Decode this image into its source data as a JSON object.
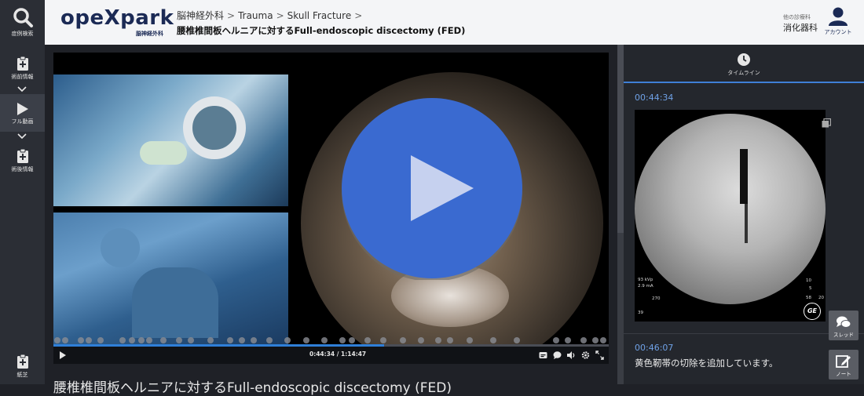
{
  "sidebar": {
    "items": [
      {
        "label": "症例検索",
        "icon": "search-icon"
      },
      {
        "label": "術前情報",
        "icon": "clipboard-plus-icon"
      },
      {
        "label": "フル動画",
        "icon": "play-icon"
      },
      {
        "label": "術後情報",
        "icon": "clipboard-plus-icon"
      },
      {
        "label": "紙芝",
        "icon": "clipboard-plus-icon"
      }
    ]
  },
  "header": {
    "logo": "opeXpark",
    "logo_sub": "脳神経外科",
    "breadcrumb": [
      "脳神経外科",
      "Trauma",
      "Skull Fracture"
    ],
    "page_subtitle": "腰椎椎間板ヘルニアに対するFull-endoscopic discectomy (FED)",
    "dept_label": "他の診療科",
    "dept_value": "消化器科",
    "account_label": "アカウント"
  },
  "player": {
    "time_display": "0:44:34 / 1:14:47",
    "progress": 0.596,
    "title_below": "腰椎椎間板ヘルニアに対するFull-endoscopic discectomy (FED)"
  },
  "panel": {
    "tab_label": "タイムライン",
    "entries": [
      {
        "time": "00:44:34",
        "xray_text": [
          "93 kVp",
          "2.9 mA",
          "270",
          "39",
          "10",
          "5",
          "58",
          "20",
          "GE"
        ]
      },
      {
        "time": "00:46:07",
        "text": "黄色靭帯の切除を追加しています。"
      }
    ]
  },
  "float_buttons": {
    "thread_label": "スレッド",
    "note_label": "ノート"
  },
  "colors": {
    "accent": "#3f7fd6",
    "brand": "#1b2a55",
    "play": "#3a6ad0"
  }
}
